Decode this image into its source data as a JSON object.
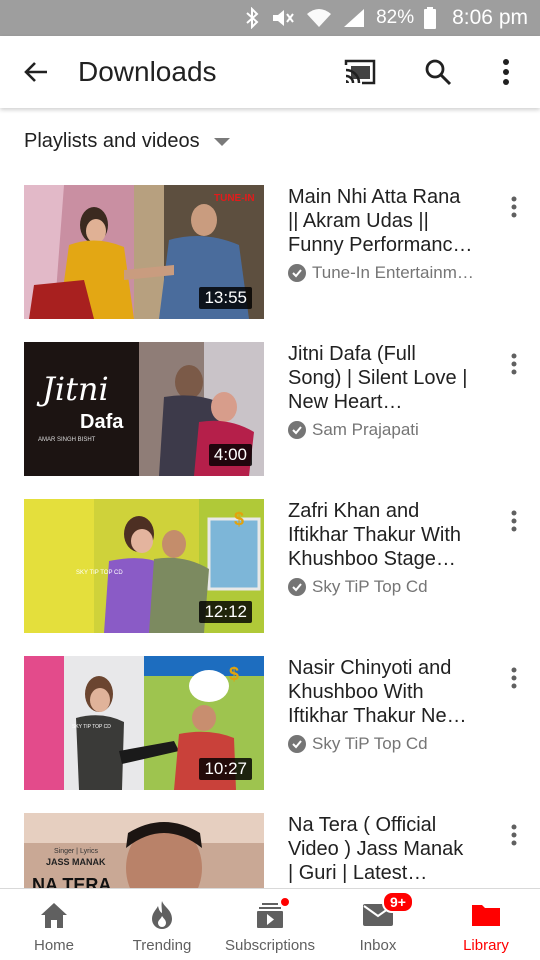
{
  "status_bar": {
    "battery": "82%",
    "time": "8:06 pm"
  },
  "app_bar": {
    "title": "Downloads"
  },
  "filter": {
    "label": "Playlists and videos"
  },
  "videos": [
    {
      "title_lines": [
        "Main Nhi Atta Rana",
        "||  Akram Udas ||",
        "Funny Performanc…"
      ],
      "channel": "Tune-In Entertainm…",
      "duration": "13:55"
    },
    {
      "title_lines": [
        "Jitni Dafa (Full",
        "Song) | Silent Love |",
        "New Heart…"
      ],
      "channel": "Sam Prajapati",
      "duration": "4:00"
    },
    {
      "title_lines": [
        "Zafri Khan and",
        "Iftikhar Thakur With",
        "Khushboo Stage…"
      ],
      "channel": "Sky TiP Top Cd",
      "duration": "12:12"
    },
    {
      "title_lines": [
        "Nasir Chinyoti and",
        "Khushboo With",
        "Iftikhar Thakur Ne…"
      ],
      "channel": "Sky TiP Top Cd",
      "duration": "10:27"
    },
    {
      "title_lines": [
        "Na Tera ( Official",
        "Video ) Jass Manak",
        "| Guri | Latest…"
      ],
      "channel": "",
      "duration": ""
    }
  ],
  "thumb_text": {
    "t1_brand": "TUNE-IN",
    "t2_word1": "Jitni",
    "t2_word2": "Dafa",
    "t2_sub": "AMAR SINGH BISHT",
    "t3_watermark": "SKY TIP TOP CD",
    "t4_watermark": "SKY TIP TOP CD",
    "t5_small1": "Singer | Lyrics",
    "t5_small2": "JASS MANAK",
    "t5_big": "NA TERA"
  },
  "nav": {
    "home": "Home",
    "trending": "Trending",
    "subscriptions": "Subscriptions",
    "inbox": "Inbox",
    "inbox_badge": "9+",
    "library": "Library"
  },
  "colors": {
    "accent": "#ff0000",
    "status_bar": "#9e9e9e"
  }
}
